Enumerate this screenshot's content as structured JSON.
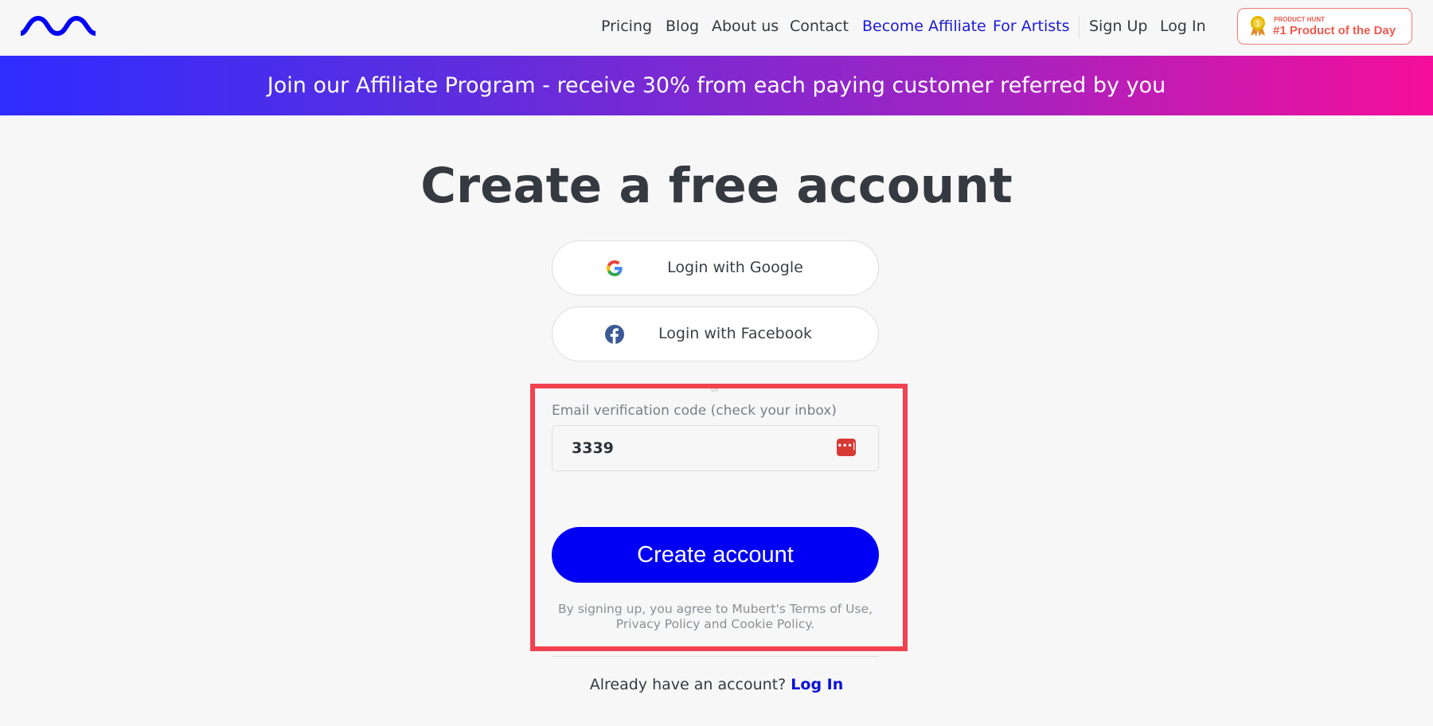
{
  "nav": {
    "links": [
      "Pricing",
      "Blog",
      "About us",
      "Contact",
      "Become Affiliate",
      "For Artists",
      "Sign Up",
      "Log In"
    ],
    "badge": {
      "small": "PRODUCT HUNT",
      "big": "#1 Product of the Day"
    }
  },
  "banner": {
    "text": "Join our Affiliate Program - receive 30% from each paying customer referred by you"
  },
  "main": {
    "title": "Create a free account",
    "google_label": "Login with Google",
    "facebook_label": "Login with Facebook",
    "or": "or",
    "code_label": "Email verification code (check your inbox)",
    "code_value": "3339",
    "password_manager_icon": "•••|",
    "create_label": "Create account",
    "terms": "By signing up, you agree to Mubert's Terms of Use, Privacy Policy and Cookie Policy.",
    "already_text": "Already have an account?",
    "login_link": "Log In"
  },
  "colors": {
    "accent": "#0000f5",
    "highlight": "#f2424f",
    "badge": "#ef5a50"
  }
}
